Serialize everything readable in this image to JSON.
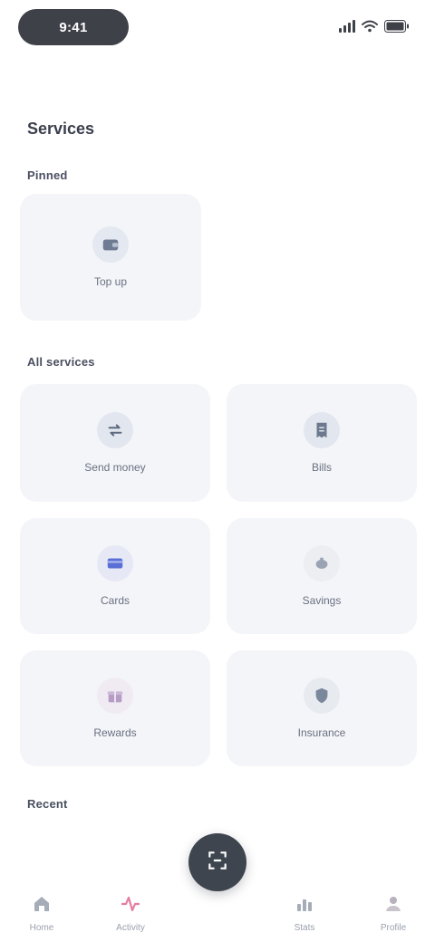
{
  "status_bar": {
    "time": "9:41"
  },
  "header": {
    "title": "Services"
  },
  "sections": [
    {
      "label": "Pinned"
    },
    {
      "label": "All services"
    },
    {
      "label": "Recent"
    }
  ],
  "pinned_tiles": [
    {
      "label": "Top up",
      "icon": "wallet-icon"
    }
  ],
  "service_tiles": [
    {
      "label": "Send money",
      "icon": "transfer-icon"
    },
    {
      "label": "Bills",
      "icon": "receipt-icon"
    },
    {
      "label": "Cards",
      "icon": "card-icon"
    },
    {
      "label": "Savings",
      "icon": "piggy-icon"
    },
    {
      "label": "Rewards",
      "icon": "gift-icon"
    },
    {
      "label": "Insurance",
      "icon": "shield-icon"
    }
  ],
  "bottom_nav": {
    "items": [
      {
        "label": "Home",
        "icon": "home-icon"
      },
      {
        "label": "Activity",
        "icon": "activity-icon"
      },
      {
        "label": "Stats",
        "icon": "chart-icon"
      },
      {
        "label": "Profile",
        "icon": "user-icon"
      }
    ],
    "center_icon": "scan-icon"
  },
  "colors": {
    "tile_bg": "#f4f5f9",
    "dark": "#3e454f",
    "accent_blue": "#5a6fd6",
    "accent_pink": "#e77aa0"
  }
}
